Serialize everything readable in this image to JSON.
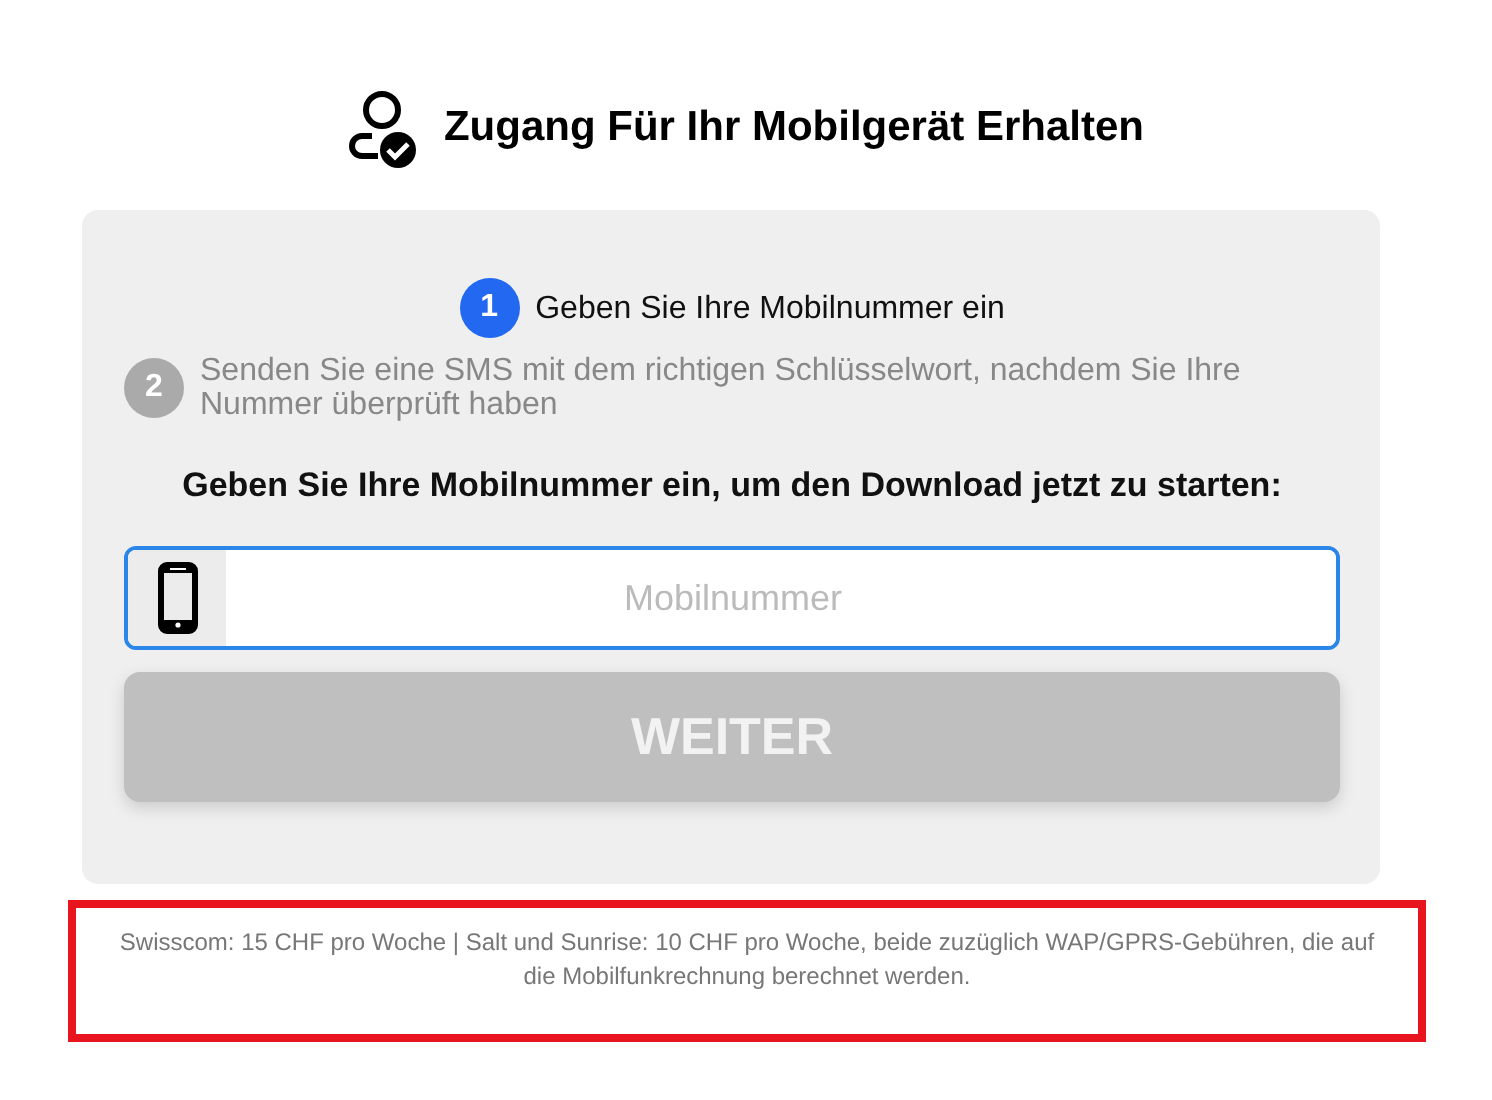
{
  "title": "Zugang Für Ihr Mobilgerät Erhalten",
  "steps": [
    {
      "number": "1",
      "text": "Geben Sie Ihre Mobilnummer ein",
      "active": true
    },
    {
      "number": "2",
      "text": "Senden Sie eine SMS mit dem richtigen Schlüsselwort, nachdem Sie Ihre Nummer überprüft haben",
      "active": false
    }
  ],
  "prompt": "Geben Sie Ihre Mobilnummer ein, um den Download jetzt zu starten:",
  "phone_field": {
    "placeholder": "Mobilnummer"
  },
  "submit_button": {
    "label": "WEITER",
    "disabled": true
  },
  "footer_note": "Swisscom: 15 CHF pro Woche | Salt und Sunrise: 10 CHF pro Woche, beide zuzüglich WAP/GPRS-Gebühren, die auf die Mobilfunkrechnung berechnet werden."
}
